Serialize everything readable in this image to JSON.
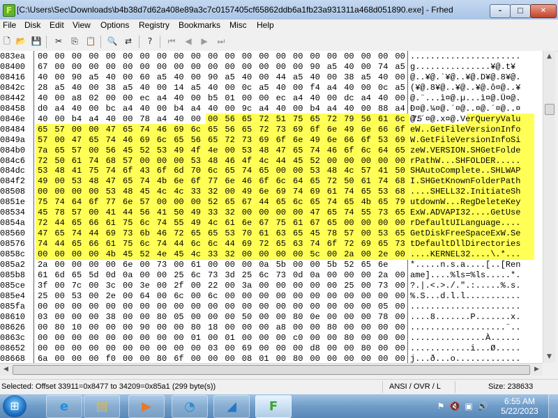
{
  "window": {
    "title": "[C:\\Users\\Sec\\Downloads\\b4b38d7d62a408e89a3c7c0157405cf65862ddb6a1fb23a931311a468d051890.exe] - Frhed",
    "app_icon_letter": "F",
    "controls": {
      "minimize": "–",
      "maximize": "□",
      "close": "✕"
    }
  },
  "menu": [
    "File",
    "Disk",
    "Edit",
    "View",
    "Options",
    "Registry",
    "Bookmarks",
    "Misc",
    "Help"
  ],
  "toolbar_icons": [
    "new-file-icon",
    "open-folder-icon",
    "save-icon",
    "cut-icon",
    "copy-icon",
    "paste-icon",
    "find-icon",
    "replace-icon",
    "help-icon",
    "bookmark-first-icon",
    "bookmark-prev-icon",
    "bookmark-next-icon",
    "bookmark-last-icon"
  ],
  "toolbar_glyphs": [
    "🗋",
    "📂",
    "💾",
    "✂",
    "⎘",
    "📋",
    "🔍",
    "⇄",
    "?",
    "⏮",
    "◀",
    "▶",
    "⏭"
  ],
  "hex": {
    "selection_color": "#ffff55",
    "rows": [
      {
        "offset": "083ea",
        "bytes": [
          "00",
          "00",
          "00",
          "00",
          "00",
          "00",
          "00",
          "00",
          "00",
          "00",
          "00",
          "00",
          "00",
          "00",
          "00",
          "00",
          "00",
          "00",
          "00",
          "00",
          "00",
          "00"
        ],
        "ascii": "......................",
        "hl_start": -1,
        "hl_end": -1
      },
      {
        "offset": "08400",
        "bytes": [
          "67",
          "00",
          "00",
          "00",
          "00",
          "00",
          "00",
          "00",
          "00",
          "00",
          "00",
          "00",
          "00",
          "00",
          "00",
          "00",
          "90",
          "a5",
          "40",
          "00",
          "74",
          "a5"
        ],
        "ascii": "g...............¥@.t¥",
        "hl_start": -1,
        "hl_end": -1
      },
      {
        "offset": "08416",
        "bytes": [
          "40",
          "00",
          "90",
          "a5",
          "40",
          "00",
          "60",
          "a5",
          "40",
          "00",
          "90",
          "a5",
          "40",
          "00",
          "44",
          "a5",
          "40",
          "00",
          "38",
          "a5",
          "40",
          "00"
        ],
        "ascii": "@..¥@.`¥@..¥@.D¥@.8¥@.",
        "hl_start": -1,
        "hl_end": -1
      },
      {
        "offset": "0842c",
        "bytes": [
          "28",
          "a5",
          "40",
          "00",
          "38",
          "a5",
          "40",
          "00",
          "14",
          "a5",
          "40",
          "00",
          "0c",
          "a5",
          "40",
          "00",
          "f4",
          "a4",
          "40",
          "00",
          "0c",
          "a5"
        ],
        "ascii": "(¥@.8¥@..¥@..¥@.ô¤@..¥",
        "hl_start": -1,
        "hl_end": -1
      },
      {
        "offset": "08442",
        "bytes": [
          "40",
          "00",
          "a8",
          "02",
          "00",
          "00",
          "ec",
          "a4",
          "40",
          "00",
          "b5",
          "01",
          "00",
          "00",
          "ec",
          "a4",
          "40",
          "00",
          "dc",
          "a4",
          "40",
          "00"
        ],
        "ascii": "@.¨...ì¤@.µ...ì¤@.Ü¤@.",
        "hl_start": -1,
        "hl_end": -1
      },
      {
        "offset": "08458",
        "bytes": [
          "d0",
          "a4",
          "40",
          "00",
          "bc",
          "a4",
          "40",
          "00",
          "b4",
          "a4",
          "40",
          "00",
          "9c",
          "a4",
          "40",
          "00",
          "b4",
          "a4",
          "40",
          "00",
          "88",
          "a4"
        ],
        "ascii": "Ð¤@.¼¤@.´¤@..¤@.´¤@..¤",
        "hl_start": -1,
        "hl_end": -1
      },
      {
        "offset": "0846e",
        "bytes": [
          "40",
          "00",
          "b4",
          "a4",
          "40",
          "00",
          "78",
          "a4",
          "40",
          "00",
          "00",
          "56",
          "65",
          "72",
          "51",
          "75",
          "65",
          "72",
          "79",
          "56",
          "61",
          "6c",
          "75"
        ],
        "ascii": "@.´¤@.x¤@.VerQueryValu",
        "hl_start": 10,
        "hl_end": 21
      },
      {
        "offset": "08484",
        "bytes": [
          "65",
          "57",
          "00",
          "00",
          "47",
          "65",
          "74",
          "46",
          "69",
          "6c",
          "65",
          "56",
          "65",
          "72",
          "73",
          "69",
          "6f",
          "6e",
          "49",
          "6e",
          "66",
          "6f"
        ],
        "ascii": "eW..GetFileVersionInfo",
        "hl_start": 0,
        "hl_end": 21
      },
      {
        "offset": "0849a",
        "bytes": [
          "57",
          "00",
          "47",
          "65",
          "74",
          "46",
          "69",
          "6c",
          "65",
          "56",
          "65",
          "72",
          "73",
          "69",
          "6f",
          "6e",
          "49",
          "6e",
          "66",
          "6f",
          "53",
          "69"
        ],
        "ascii": "W.GetFileVersionInfoSi",
        "hl_start": 0,
        "hl_end": 21
      },
      {
        "offset": "084b0",
        "bytes": [
          "7a",
          "65",
          "57",
          "00",
          "56",
          "45",
          "52",
          "53",
          "49",
          "4f",
          "4e",
          "00",
          "53",
          "48",
          "47",
          "65",
          "74",
          "46",
          "6f",
          "6c",
          "64",
          "65"
        ],
        "ascii": "zeW.VERSION.SHGetFolde",
        "hl_start": 0,
        "hl_end": 21
      },
      {
        "offset": "084c6",
        "bytes": [
          "72",
          "50",
          "61",
          "74",
          "68",
          "57",
          "00",
          "00",
          "00",
          "53",
          "48",
          "46",
          "4f",
          "4c",
          "44",
          "45",
          "52",
          "00",
          "00",
          "00",
          "00",
          "00"
        ],
        "ascii": "rPathW...SHFOLDER.....",
        "hl_start": 0,
        "hl_end": 21
      },
      {
        "offset": "084dc",
        "bytes": [
          "53",
          "48",
          "41",
          "75",
          "74",
          "6f",
          "43",
          "6f",
          "6d",
          "70",
          "6c",
          "65",
          "74",
          "65",
          "00",
          "00",
          "53",
          "48",
          "4c",
          "57",
          "41",
          "50"
        ],
        "ascii": "SHAutoComplete..SHLWAP",
        "hl_start": 0,
        "hl_end": 21
      },
      {
        "offset": "084f2",
        "bytes": [
          "49",
          "00",
          "53",
          "48",
          "47",
          "65",
          "74",
          "4b",
          "6e",
          "6f",
          "77",
          "6e",
          "46",
          "6f",
          "6c",
          "64",
          "65",
          "72",
          "50",
          "61",
          "74",
          "68"
        ],
        "ascii": "I.SHGetKnownFolderPath",
        "hl_start": 0,
        "hl_end": 21
      },
      {
        "offset": "08508",
        "bytes": [
          "00",
          "00",
          "00",
          "00",
          "53",
          "48",
          "45",
          "4c",
          "4c",
          "33",
          "32",
          "00",
          "49",
          "6e",
          "69",
          "74",
          "69",
          "61",
          "74",
          "65",
          "53",
          "68"
        ],
        "ascii": "....SHELL32.InitiateSh",
        "hl_start": 0,
        "hl_end": 21
      },
      {
        "offset": "0851e",
        "bytes": [
          "75",
          "74",
          "64",
          "6f",
          "77",
          "6e",
          "57",
          "00",
          "00",
          "00",
          "52",
          "65",
          "67",
          "44",
          "65",
          "6c",
          "65",
          "74",
          "65",
          "4b",
          "65",
          "79"
        ],
        "ascii": "utdownW...RegDeleteKey",
        "hl_start": 0,
        "hl_end": 21
      },
      {
        "offset": "08534",
        "bytes": [
          "45",
          "78",
          "57",
          "00",
          "41",
          "44",
          "56",
          "41",
          "50",
          "49",
          "33",
          "32",
          "00",
          "00",
          "00",
          "00",
          "47",
          "65",
          "74",
          "55",
          "73",
          "65"
        ],
        "ascii": "ExW.ADVAPI32....GetUse",
        "hl_start": 0,
        "hl_end": 21
      },
      {
        "offset": "0854a",
        "bytes": [
          "72",
          "44",
          "65",
          "66",
          "61",
          "75",
          "6c",
          "74",
          "55",
          "49",
          "4c",
          "61",
          "6e",
          "67",
          "75",
          "61",
          "67",
          "65",
          "00",
          "00",
          "00",
          "00"
        ],
        "ascii": "rDefaultUILanguage....",
        "hl_start": 0,
        "hl_end": 21
      },
      {
        "offset": "08560",
        "bytes": [
          "47",
          "65",
          "74",
          "44",
          "69",
          "73",
          "6b",
          "46",
          "72",
          "65",
          "65",
          "53",
          "70",
          "61",
          "63",
          "65",
          "45",
          "78",
          "57",
          "00",
          "53",
          "65"
        ],
        "ascii": "GetDiskFreeSpaceExW.Se",
        "hl_start": 0,
        "hl_end": 21
      },
      {
        "offset": "08576",
        "bytes": [
          "74",
          "44",
          "65",
          "66",
          "61",
          "75",
          "6c",
          "74",
          "44",
          "6c",
          "6c",
          "44",
          "69",
          "72",
          "65",
          "63",
          "74",
          "6f",
          "72",
          "69",
          "65",
          "73"
        ],
        "ascii": "tDefaultDllDirectories",
        "hl_start": 0,
        "hl_end": 21
      },
      {
        "offset": "0858c",
        "bytes": [
          "00",
          "00",
          "00",
          "00",
          "4b",
          "45",
          "52",
          "4e",
          "45",
          "4c",
          "33",
          "32",
          "00",
          "00",
          "00",
          "00",
          "5c",
          "00",
          "2a",
          "00",
          "2e",
          "00"
        ],
        "ascii": "....KERNEL32....\\.*...",
        "hl_start": 0,
        "hl_end": 21
      },
      {
        "offset": "085a2",
        "bytes": [
          "2a",
          "00",
          "00",
          "00",
          "00",
          "6e",
          "00",
          "73",
          "00",
          "61",
          "00",
          "00",
          "00",
          "0a",
          "5b",
          "00",
          "00",
          "5b",
          "52",
          "65",
          "6e"
        ],
        "ascii": "*.....n.s.a....[..[Ren",
        "hl_start": -1,
        "hl_end": -1
      },
      {
        "offset": "085b8",
        "bytes": [
          "61",
          "6d",
          "65",
          "5d",
          "0d",
          "0a",
          "00",
          "00",
          "25",
          "6c",
          "73",
          "3d",
          "25",
          "6c",
          "73",
          "0d",
          "0a",
          "00",
          "00",
          "00",
          "2a",
          "00"
        ],
        "ascii": "ame]....%ls=%ls.....*.",
        "hl_start": -1,
        "hl_end": -1
      },
      {
        "offset": "085ce",
        "bytes": [
          "3f",
          "00",
          "7c",
          "00",
          "3c",
          "00",
          "3e",
          "00",
          "2f",
          "00",
          "22",
          "00",
          "3a",
          "00",
          "00",
          "00",
          "00",
          "00",
          "25",
          "00",
          "73",
          "00"
        ],
        "ascii": "?.|.<.>./.\".:.....%.s.",
        "hl_start": -1,
        "hl_end": -1
      },
      {
        "offset": "085e4",
        "bytes": [
          "25",
          "00",
          "53",
          "00",
          "2e",
          "00",
          "64",
          "00",
          "6c",
          "00",
          "6c",
          "00",
          "00",
          "00",
          "00",
          "00",
          "00",
          "00",
          "00",
          "00",
          "00",
          "00"
        ],
        "ascii": "%.S...d.l.l...........",
        "hl_start": -1,
        "hl_end": -1
      },
      {
        "offset": "085fa",
        "bytes": [
          "00",
          "00",
          "00",
          "00",
          "00",
          "00",
          "00",
          "00",
          "00",
          "00",
          "00",
          "00",
          "00",
          "00",
          "00",
          "00",
          "00",
          "00",
          "00",
          "00",
          "05",
          "00"
        ],
        "ascii": "......................",
        "hl_start": -1,
        "hl_end": -1
      },
      {
        "offset": "08610",
        "bytes": [
          "03",
          "00",
          "00",
          "00",
          "38",
          "00",
          "00",
          "80",
          "05",
          "00",
          "00",
          "00",
          "50",
          "00",
          "00",
          "80",
          "0e",
          "00",
          "00",
          "00",
          "78",
          "00"
        ],
        "ascii": "....8.......P.......x.",
        "hl_start": -1,
        "hl_end": -1
      },
      {
        "offset": "08626",
        "bytes": [
          "00",
          "80",
          "10",
          "00",
          "00",
          "00",
          "90",
          "00",
          "00",
          "80",
          "18",
          "00",
          "00",
          "00",
          "a8",
          "00",
          "00",
          "80",
          "00",
          "00",
          "00",
          "00"
        ],
        "ascii": "...................¨..",
        "hl_start": -1,
        "hl_end": -1
      },
      {
        "offset": "0863c",
        "bytes": [
          "00",
          "00",
          "00",
          "00",
          "00",
          "00",
          "00",
          "00",
          "00",
          "01",
          "00",
          "01",
          "00",
          "00",
          "00",
          "c0",
          "00",
          "00",
          "80",
          "00",
          "00",
          "00"
        ],
        "ascii": "...............À......",
        "hl_start": -1,
        "hl_end": -1
      },
      {
        "offset": "08652",
        "bytes": [
          "00",
          "00",
          "00",
          "00",
          "00",
          "00",
          "00",
          "00",
          "00",
          "00",
          "03",
          "00",
          "69",
          "00",
          "00",
          "00",
          "d8",
          "00",
          "00",
          "80",
          "00",
          "00"
        ],
        "ascii": "............i...Ø.....",
        "hl_start": -1,
        "hl_end": -1
      },
      {
        "offset": "08668",
        "bytes": [
          "6a",
          "00",
          "00",
          "00",
          "f0",
          "00",
          "00",
          "80",
          "6f",
          "00",
          "00",
          "00",
          "08",
          "01",
          "00",
          "80",
          "00",
          "00",
          "00",
          "00",
          "00",
          "00"
        ],
        "ascii": "j...ð...o.............",
        "hl_start": -1,
        "hl_end": -1
      }
    ]
  },
  "status": {
    "selection": "Selected: Offset 33911=0x8477 to 34209=0x85a1 (299 byte(s))",
    "mode": "ANSI / OVR / L",
    "size": "Size: 238633"
  },
  "taskbar": {
    "start_glyph": "⊞",
    "items": [
      {
        "name": "internet-explorer-icon",
        "glyph": "e",
        "color": "#1e8fe0"
      },
      {
        "name": "file-explorer-icon",
        "glyph": "▤",
        "color": "#e3b64a"
      },
      {
        "name": "media-player-icon",
        "glyph": "▶",
        "color": "#e8782a"
      },
      {
        "name": "tool-icon",
        "glyph": "◔",
        "color": "#2a8fd8"
      },
      {
        "name": "wireshark-icon",
        "glyph": "◢",
        "color": "#2577c8"
      },
      {
        "name": "frhed-icon",
        "glyph": "F",
        "color": "#3aa52a"
      }
    ],
    "tray": [
      "⚑",
      "🔇",
      "▣",
      "🔊"
    ],
    "time": "6:55 AM",
    "date": "5/22/2023"
  }
}
